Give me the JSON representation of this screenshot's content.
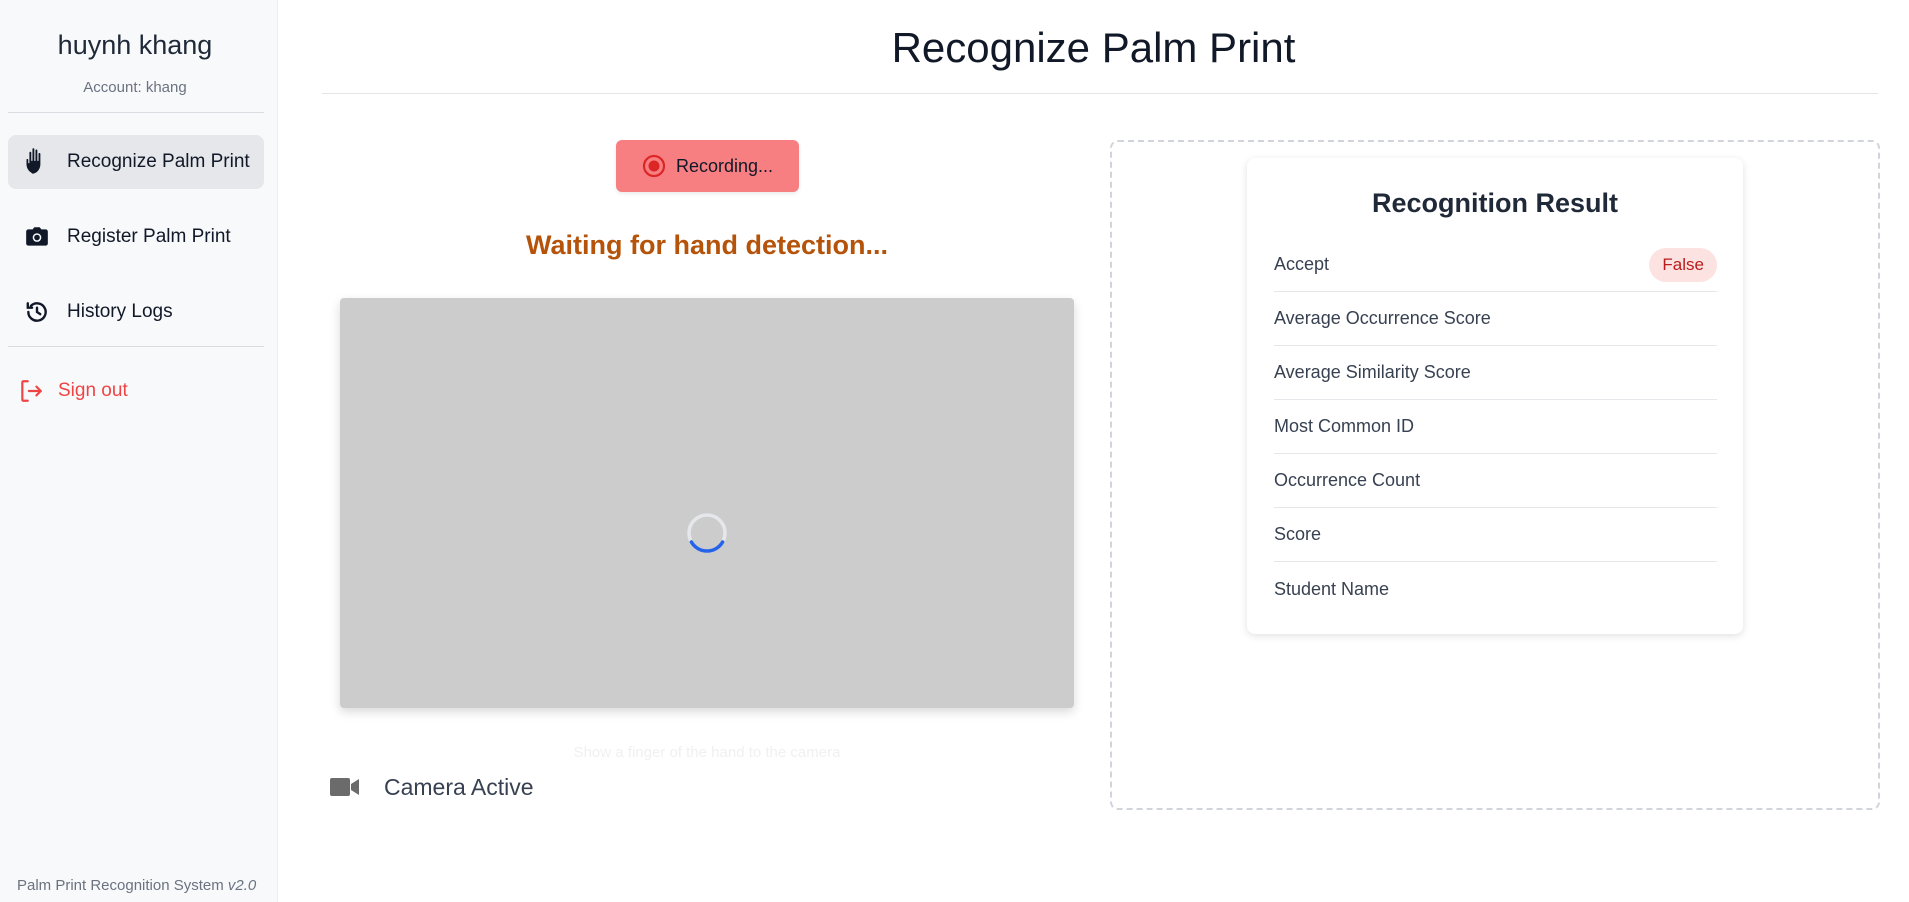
{
  "sidebar": {
    "user_name": "huynh khang",
    "account": "Account: khang",
    "items": [
      {
        "label": "Recognize Palm Print",
        "icon": "hand-icon",
        "active": true
      },
      {
        "label": "Register Palm Print",
        "icon": "camera-icon",
        "active": false
      },
      {
        "label": "History Logs",
        "icon": "history-icon",
        "active": false
      }
    ],
    "sign_out": "Sign out",
    "footer_text": "Palm Print Recognition System",
    "footer_version": "v2.0"
  },
  "header": {
    "title": "Recognize Palm Print"
  },
  "capture": {
    "record_label": "Recording...",
    "status_text": "Waiting for hand detection...",
    "overlay_text": "Show a finger of the hand to the camera",
    "camera_status": "Camera Active"
  },
  "result": {
    "title": "Recognition Result",
    "rows": [
      {
        "label": "Accept",
        "value": "False"
      },
      {
        "label": "Average Occurrence Score",
        "value": ""
      },
      {
        "label": "Average Similarity Score",
        "value": ""
      },
      {
        "label": "Most Common ID",
        "value": ""
      },
      {
        "label": "Occurrence Count",
        "value": ""
      },
      {
        "label": "Score",
        "value": ""
      },
      {
        "label": "Student Name",
        "value": ""
      }
    ]
  },
  "colors": {
    "accent_red": "#ef4444",
    "recording_bg": "#f87f81",
    "status_orange": "#b45309",
    "spinner_blue": "#2563eb"
  }
}
